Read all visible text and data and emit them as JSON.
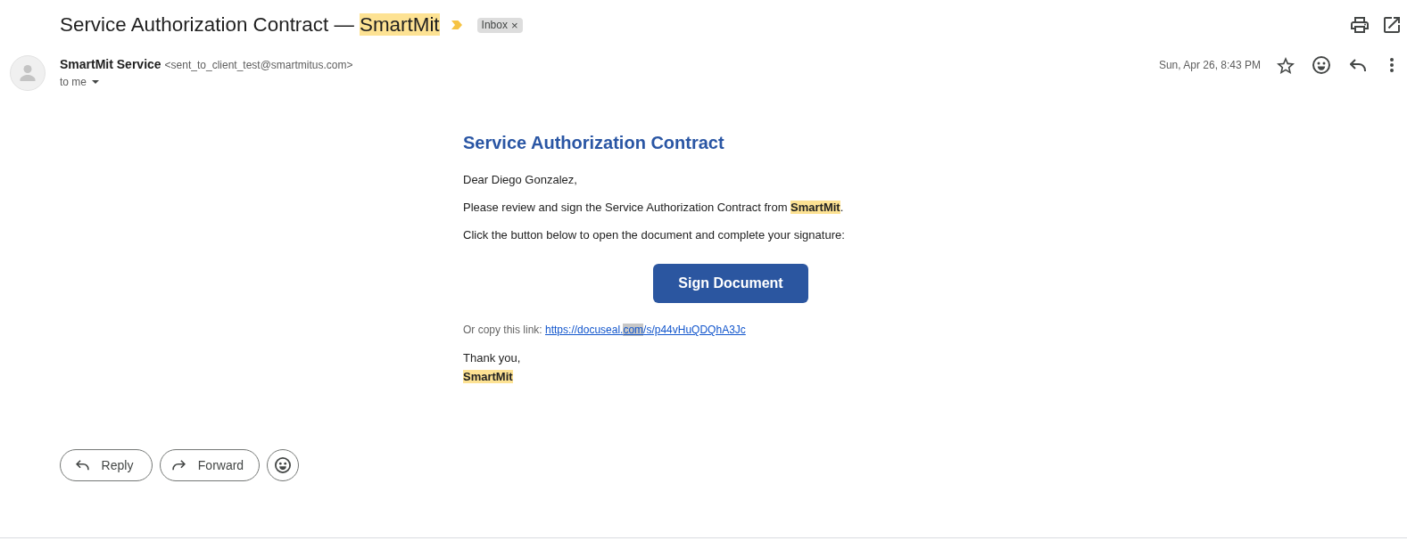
{
  "subject": {
    "segments": [
      {
        "text": "Service Authorization Contract — ",
        "highlighted": false
      },
      {
        "text": "SmartMit",
        "highlighted": true
      }
    ],
    "important": true,
    "labels": [
      {
        "text": "Inbox",
        "remove": "×"
      }
    ]
  },
  "sender": {
    "name": "SmartMit Service",
    "email": "<sent_to_client_test@smartmitus.com>",
    "recipient": "to me",
    "date": "Sun, Apr 26, 8:43 PM"
  },
  "message": {
    "heading": "Service Authorization Contract",
    "paragraphs": [
      {
        "segments": [
          {
            "text": "Dear Diego Gonzalez,",
            "highlighted": false
          }
        ]
      },
      {
        "segments": [
          {
            "text": "Please review and sign the Service Authorization Contract from ",
            "highlighted": false
          },
          {
            "text": "**SmartMit**",
            "highlighted": true
          },
          {
            "text": ".",
            "highlighted": false
          }
        ]
      },
      {
        "segments": [
          {
            "text": "Click the button below to open the document and complete your signature:",
            "highlighted": false
          }
        ]
      }
    ],
    "button": "Sign Document",
    "link_prompt": "Or copy this link:",
    "link": [
      {
        "text": "https://docuseal.",
        "selected": false
      },
      {
        "text": "com",
        "selected": true
      },
      {
        "text": "/s/p44vHuQDQhA3Jc",
        "selected": false
      }
    ],
    "closing": "Thank you,",
    "signature": {
      "text": "SmartMit",
      "highlighted": true
    }
  },
  "actions": [
    {
      "kind": "reply",
      "label": "Reply"
    },
    {
      "kind": "forward",
      "label": "Forward"
    },
    {
      "kind": "emoji"
    }
  ]
}
